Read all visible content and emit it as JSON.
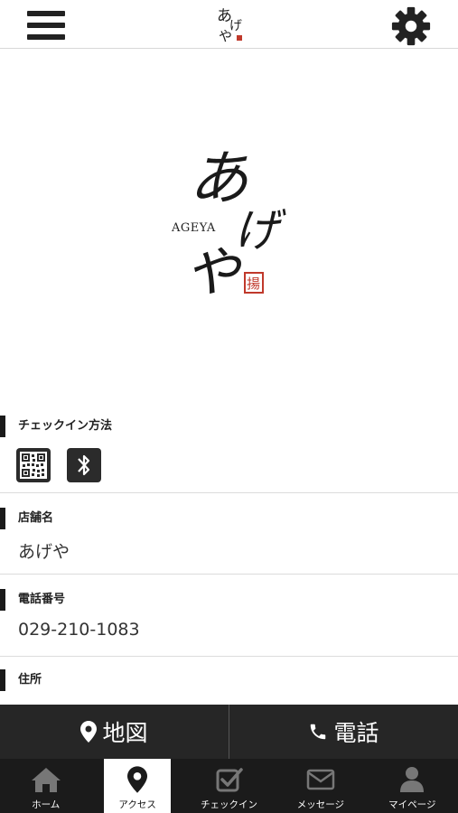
{
  "header": {
    "menu_icon": "hamburger-menu-icon",
    "logo_text": "あげや",
    "settings_icon": "gear-icon"
  },
  "hero": {
    "logo_text": "あげや",
    "logo_sub": "AGEYA",
    "seal_icon": "seal-stamp"
  },
  "sections": {
    "checkin": {
      "title": "チェックイン方法",
      "icons": [
        "qr-code-icon",
        "bluetooth-icon"
      ]
    },
    "store_name": {
      "title": "店舗名",
      "value": "あげや"
    },
    "phone": {
      "title": "電話番号",
      "value": "029-210-1083"
    },
    "address": {
      "title": "住所"
    }
  },
  "action_bar": {
    "map_label": "地図",
    "map_icon": "map-pin-icon",
    "call_label": "電話",
    "call_icon": "phone-icon"
  },
  "tabs": [
    {
      "label": "ホーム",
      "icon": "home-icon",
      "active": false
    },
    {
      "label": "アクセス",
      "icon": "map-pin-icon",
      "active": true
    },
    {
      "label": "チェックイン",
      "icon": "checkin-icon",
      "active": false
    },
    {
      "label": "メッセージ",
      "icon": "envelope-icon",
      "active": false
    },
    {
      "label": "マイページ",
      "icon": "user-icon",
      "active": false
    }
  ],
  "colors": {
    "dark_bar": "#262626",
    "tab_bar": "#1b1b1b",
    "seal_red": "#c0392b"
  }
}
